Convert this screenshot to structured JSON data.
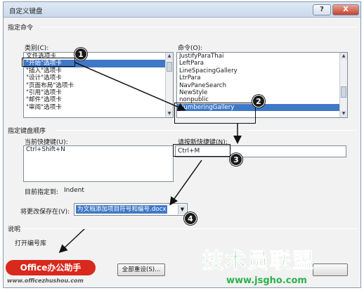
{
  "dialog": {
    "title": "自定义键盘",
    "help_label": "?",
    "close_label": "X"
  },
  "commands_section": {
    "title": "指定命令",
    "categories_label": "类别(C):",
    "categories": [
      "文件选项卡",
      "\"开始\"选项卡",
      "\"插入\"选项卡",
      "\"设计\"选项卡",
      "\"页面布局\"选项卡",
      "\"引用\"选项卡",
      "\"邮件\"选项卡",
      "\"审阅\"选项卡"
    ],
    "categories_selected": 1,
    "commands_label": "命令(O):",
    "commands": [
      "JustifyParaThai",
      "LeftPara",
      "LineSpacingGallery",
      "LtrPara",
      "NavPaneSearch",
      "NewStyle",
      "nonpublic",
      "NumberingGallery"
    ],
    "commands_selected": 7
  },
  "keyboard_section": {
    "title": "指定键盘顺序",
    "current_keys_label": "当前快捷键(U):",
    "current_keys": [
      "Ctrl+Shift+N"
    ],
    "new_key_label": "请按新快捷键(N):",
    "new_key_value": "Ctrl+M",
    "currently_assigned_label": "目前指定到:",
    "currently_assigned_value": "Indent",
    "save_in_label": "将更改保存在(V):",
    "save_in_value": "为文档添加项目符号和编号.docx"
  },
  "description_section": {
    "title": "说明",
    "text": "打开编号库"
  },
  "buttons": {
    "reset_all": "全部重设(S)..."
  },
  "callouts": [
    "1",
    "2",
    "3",
    "4"
  ],
  "watermarks": {
    "office_logo": "Office办公助手",
    "office_url": "www.officezhushou.com",
    "site_logo": "技术员联盟",
    "site_url": "www.jsgho.com"
  },
  "colors": {
    "selection": "#3f78c6",
    "callout": "#1a1a1a",
    "office_logo_bg": "#d9281c",
    "site_logo": "#2bb24c"
  }
}
